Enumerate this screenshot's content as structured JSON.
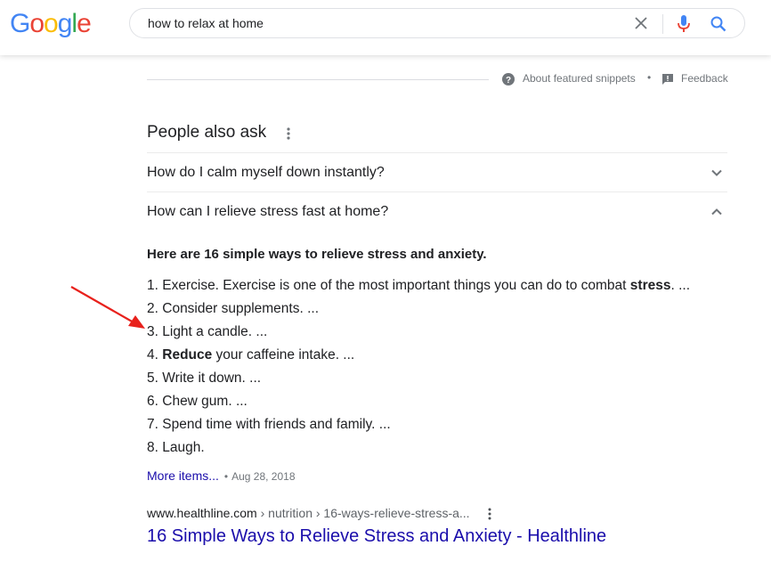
{
  "header": {
    "logo": [
      "G",
      "o",
      "o",
      "g",
      "l",
      "e"
    ],
    "search_value": "how to relax at home"
  },
  "icons": {
    "clear": "close-icon",
    "mic": "microphone-icon",
    "search": "search-icon",
    "help": "help-circle-icon",
    "feedback": "feedback-icon",
    "more": "more-vertical-icon",
    "expand": "chevron-down-icon",
    "collapse": "chevron-up-icon",
    "annotation": "red-arrow"
  },
  "colors": {
    "link": "#1a0dab",
    "arrow": "#e8211c",
    "mic_blue": "#4285f4",
    "mic_red": "#ea4335"
  },
  "snippet_footer": {
    "about_label": "About featured snippets",
    "dot": "•",
    "feedback_label": "Feedback"
  },
  "paa": {
    "title": "People also ask",
    "questions": [
      {
        "text": "How do I calm myself down instantly?",
        "expanded": false
      },
      {
        "text": "How can I relieve stress fast at home?",
        "expanded": true
      }
    ],
    "answer": {
      "heading": "Here are 16 simple ways to relieve stress and anxiety.",
      "items": [
        {
          "num": "1.",
          "pre": "Exercise. Exercise is one of the most important things you can do to combat ",
          "bold": "stress",
          "post": ". ..."
        },
        {
          "num": "2.",
          "pre": "Consider supplements. ...",
          "bold": "",
          "post": ""
        },
        {
          "num": "3.",
          "pre": "Light a candle. ...",
          "bold": "",
          "post": ""
        },
        {
          "num": "4.",
          "pre": "",
          "bold": "Reduce",
          "post": " your caffeine intake. ..."
        },
        {
          "num": "5.",
          "pre": "Write it down. ...",
          "bold": "",
          "post": ""
        },
        {
          "num": "6.",
          "pre": "Chew gum. ...",
          "bold": "",
          "post": ""
        },
        {
          "num": "7.",
          "pre": "Spend time with friends and family. ...",
          "bold": "",
          "post": ""
        },
        {
          "num": "8.",
          "pre": "Laugh.",
          "bold": "",
          "post": ""
        }
      ],
      "more_label": "More items...",
      "separator": "•",
      "date": "Aug 28, 2018"
    }
  },
  "result": {
    "domain": "www.healthline.com",
    "path": " › nutrition › 16-ways-relieve-stress-a...",
    "title": "16 Simple Ways to Relieve Stress and Anxiety - Healthline"
  }
}
